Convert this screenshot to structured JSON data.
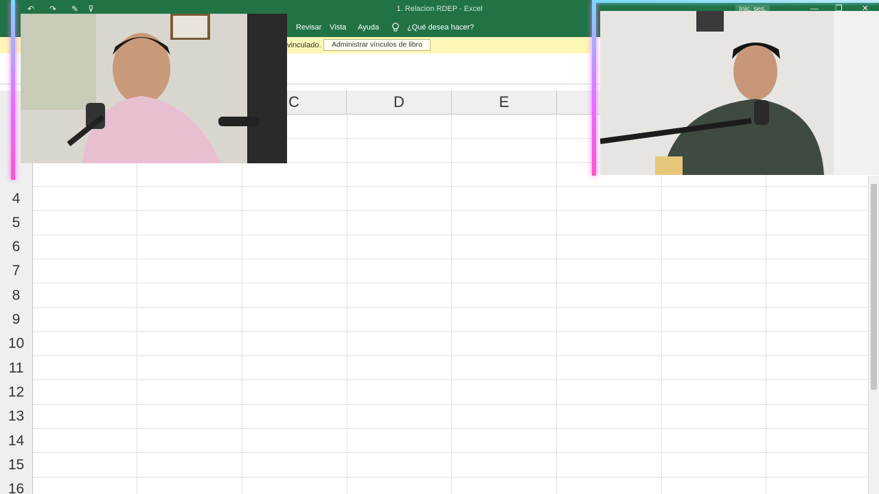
{
  "window": {
    "title": "1. Relacion RDEP  -  Excel",
    "signin_label": "Inic. ses.",
    "minimize": "—",
    "restore": "❐",
    "close": "✕"
  },
  "ribbon": {
    "tabs": [
      "Revisar",
      "Vista",
      "Ayuda"
    ],
    "tell_me": "¿Qué desea hacer?"
  },
  "message_bar": {
    "text": "vinculado.",
    "button_label": "Administrar vínculos de libro"
  },
  "sheet": {
    "columns": [
      "C",
      "D",
      "E"
    ],
    "rows": [
      "4",
      "5",
      "6",
      "7",
      "8",
      "9",
      "10",
      "11",
      "12",
      "13",
      "14",
      "15",
      "16"
    ]
  },
  "colors": {
    "excel_green": "#217346",
    "message_bar": "#fcf7b6",
    "overlay_glow": "#e96bff"
  }
}
